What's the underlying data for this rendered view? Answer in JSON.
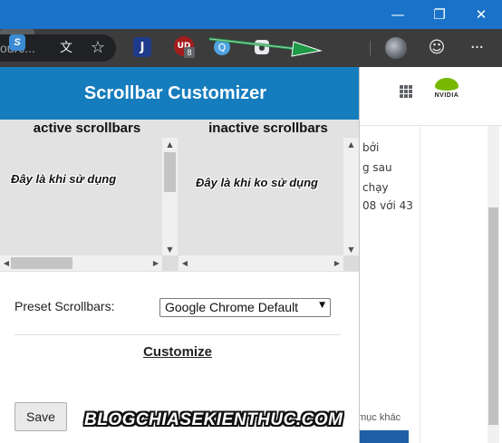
{
  "window": {
    "minimize_glyph": "—",
    "maximize_glyph": "❐",
    "close_glyph": "✕"
  },
  "toolbar": {
    "omnibox_text": "ourc...",
    "translate_glyph": "文",
    "star_glyph": "☆",
    "extensions": [
      {
        "name": "j-extension-icon",
        "label": "J"
      },
      {
        "name": "ud-extension-icon",
        "label": "UD",
        "badge": "8"
      },
      {
        "name": "search-extension-icon",
        "label": "Q"
      },
      {
        "name": "camera-extension-icon",
        "label": "●"
      },
      {
        "name": "scrollbar-customizer-icon",
        "label": "S"
      }
    ],
    "smile_glyph": "☺",
    "more_glyph": "···"
  },
  "popup": {
    "title": "Scrollbar Customizer",
    "active_heading": "active scrollbars",
    "active_caption": "Đây là khi sử dụng",
    "inactive_heading": "inactive scrollbars",
    "inactive_caption": "Đây là khi ko sử dụng",
    "preset_label": "Preset Scrollbars:",
    "preset_value": "Google Chrome Default",
    "customize_label": "Customize",
    "save_label": "Save"
  },
  "page": {
    "article_lines": [
      "bởi",
      "g sau",
      "chạy",
      "08 với 43"
    ],
    "related_label": "mục khác",
    "logo_text": "NVIDIA"
  },
  "watermark": "BLOGCHIASEKIENTHUC.COM",
  "colors": {
    "titlebar": "#1a73c9",
    "toolbar": "#3c3c3c",
    "popup_header": "#157cbd",
    "arrow": "#1f9a48",
    "nvidia_green": "#76b900"
  }
}
